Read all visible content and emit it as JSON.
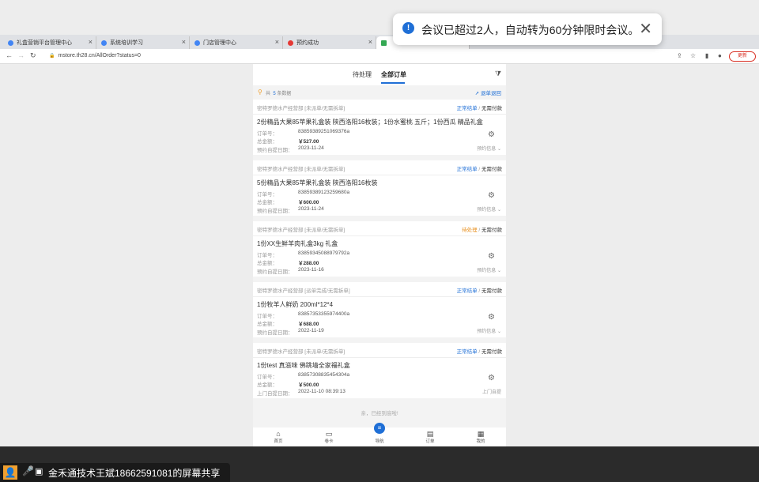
{
  "browser": {
    "tabs": [
      {
        "label": "礼盒营销平台管理中心",
        "color": "#4285f4"
      },
      {
        "label": "系统培训学习",
        "color": "#4285f4"
      },
      {
        "label": "门店管理中心",
        "color": "#4285f4"
      },
      {
        "label": "预约成功",
        "color": "#e53935"
      },
      {
        "label": "",
        "color": "#34a853"
      }
    ],
    "url": "mstore.th28.cn/AllOrder?status=0",
    "update_label": "更新"
  },
  "toast": {
    "text": "会议已超过2人，自动转为60分钟限时会议。"
  },
  "app": {
    "tabs": {
      "pending": "待处理",
      "all": "全部订单"
    },
    "summary": {
      "prefix": "共",
      "count": "5",
      "suffix": "条数据",
      "return_label": "退单退回"
    },
    "labels": {
      "order_no": "订单号：",
      "total": "总金额：",
      "pickup_date": "预约自提日期：",
      "door_pickup_date": "上门自提日期：",
      "reserve_info": "预约信息",
      "door_pickup": "上门自提",
      "separator": "/",
      "no_pay": "无需付款"
    },
    "orders": [
      {
        "shop": "密特罗德水产经营部 [未派单/无需拆单]",
        "status": "正常结单",
        "status_type": "normal",
        "title": "2份精品大果85苹果礼盒装 陕西洛阳16枚装；1份水蜜桃 五斤；1份西瓜 精品礼盒",
        "order_no": "83859389251069376a",
        "amount": "￥527.00",
        "date_label": "预约自提日期：",
        "date": "2023-11-24",
        "info": "预约信息"
      },
      {
        "shop": "密特罗德水产经营部 [未派单/无需拆单]",
        "status": "正常结单",
        "status_type": "normal",
        "title": "5份精品大果85苹果礼盒装 陕西洛阳16枚装",
        "order_no": "83859389123259680a",
        "amount": "￥600.00",
        "date_label": "预约自提日期：",
        "date": "2023-11-24",
        "info": "预约信息"
      },
      {
        "shop": "密特罗德水产经营部 [未派单/无需拆单]",
        "status": "待处理",
        "status_type": "pending",
        "title": "1份XX生鲜羊肉礼盒3kg 礼盒",
        "order_no": "83859345088979792a",
        "amount": "￥288.00",
        "date_label": "预约自提日期：",
        "date": "2023-11-16",
        "info": "预约信息"
      },
      {
        "shop": "密特罗德水产经营部 [派单完成/无需拆单]",
        "status": "正常结单",
        "status_type": "normal",
        "title": "1份牧羊人鲜奶 200ml*12*4",
        "order_no": "83857353355974400a",
        "amount": "￥688.00",
        "date_label": "预约自提日期：",
        "date": "2022-11-19",
        "info": "预约信息"
      },
      {
        "shop": "密特罗德水产经营部 [未派单/无需拆单]",
        "status": "正常结单",
        "status_type": "normal",
        "title": "1份test 真滋味 佛跳墙全家福礼盒",
        "order_no": "83857308835454304a",
        "amount": "￥500.00",
        "date_label": "上门自提日期：",
        "date": "2022-11-10 08:39:13",
        "info": "上门自提"
      }
    ],
    "end_tip": "亲，已经到底啦!",
    "bottom_nav": [
      "首页",
      "卷卡",
      "导航",
      "订单",
      "我的"
    ]
  },
  "share_bar": {
    "text": "金禾通技术王斌18662591081的屏幕共享"
  }
}
